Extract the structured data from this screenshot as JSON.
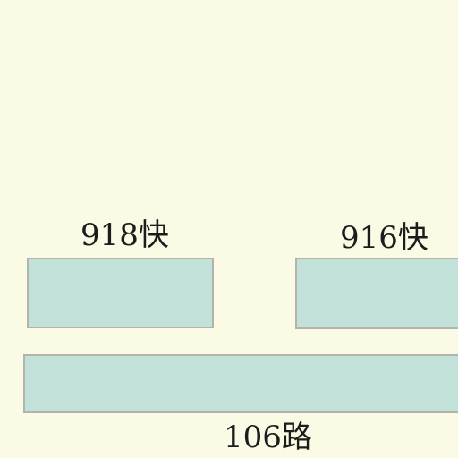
{
  "map": {
    "background_color": "#fbfae4",
    "platform_color": "#c2e1d8",
    "platform_border_color": "#b2b2ae",
    "route_labels": {
      "route_918": "918快",
      "route_916": "916快",
      "route_106": "106路"
    }
  }
}
